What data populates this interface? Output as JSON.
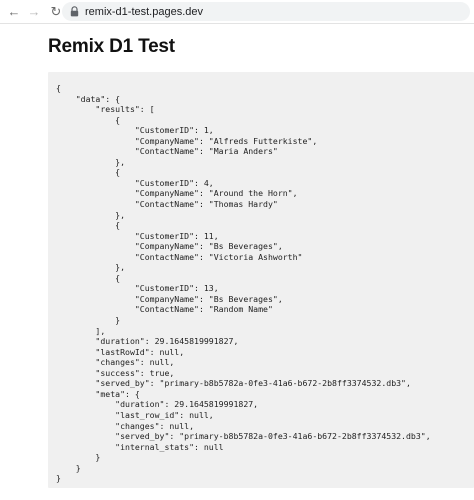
{
  "browser": {
    "back_glyph": "←",
    "forward_glyph": "→",
    "reload_glyph": "↻",
    "url": "remix-d1-test.pages.dev"
  },
  "page": {
    "title": "Remix D1 Test"
  },
  "json_output": "{\n    \"data\": {\n        \"results\": [\n            {\n                \"CustomerID\": 1,\n                \"CompanyName\": \"Alfreds Futterkiste\",\n                \"ContactName\": \"Maria Anders\"\n            },\n            {\n                \"CustomerID\": 4,\n                \"CompanyName\": \"Around the Horn\",\n                \"ContactName\": \"Thomas Hardy\"\n            },\n            {\n                \"CustomerID\": 11,\n                \"CompanyName\": \"Bs Beverages\",\n                \"ContactName\": \"Victoria Ashworth\"\n            },\n            {\n                \"CustomerID\": 13,\n                \"CompanyName\": \"Bs Beverages\",\n                \"ContactName\": \"Random Name\"\n            }\n        ],\n        \"duration\": 29.1645819991827,\n        \"lastRowId\": null,\n        \"changes\": null,\n        \"success\": true,\n        \"served_by\": \"primary-b8b5782a-0fe3-41a6-b672-2b8ff3374532.db3\",\n        \"meta\": {\n            \"duration\": 29.1645819991827,\n            \"last_row_id\": null,\n            \"changes\": null,\n            \"served_by\": \"primary-b8b5782a-0fe3-41a6-b672-2b8ff3374532.db3\",\n            \"internal_stats\": null\n        }\n    }\n}"
}
